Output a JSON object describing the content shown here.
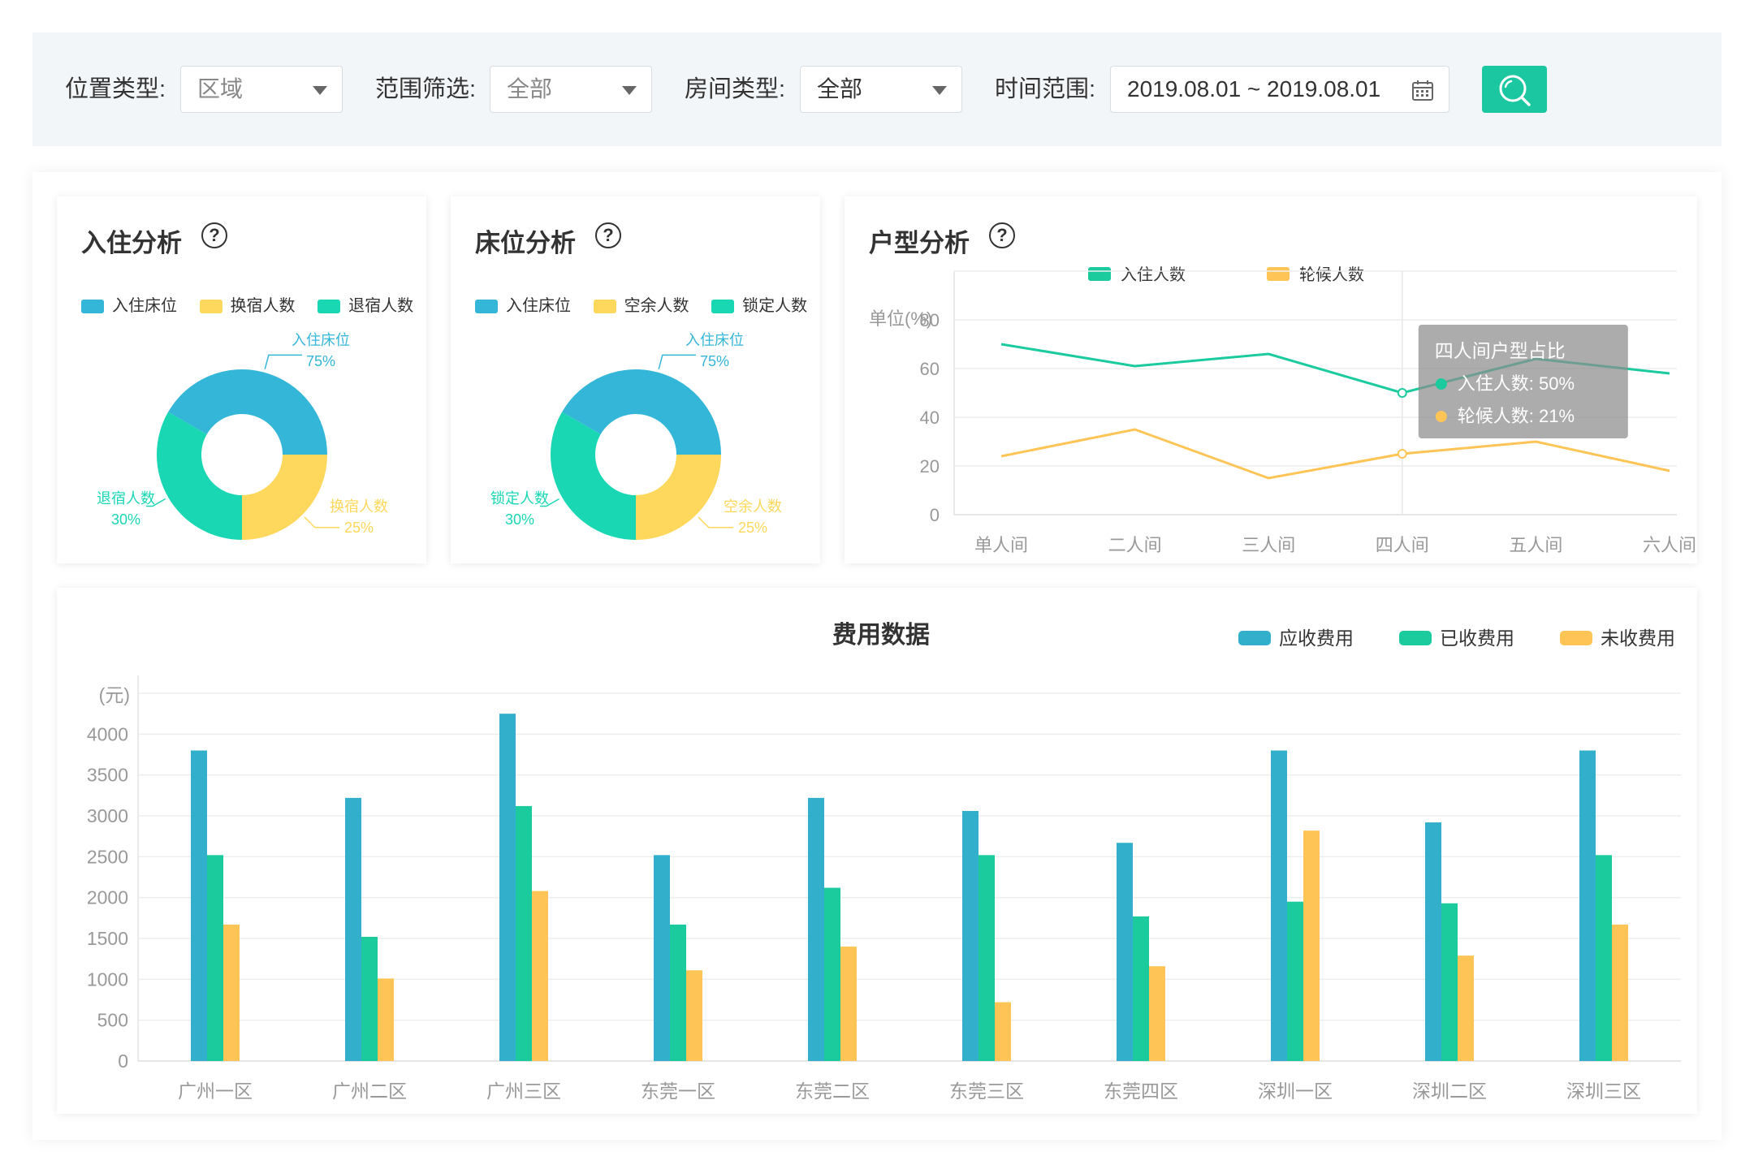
{
  "filters": [
    {
      "label": "位置类型:",
      "value": "区域"
    },
    {
      "label": "范围筛选:",
      "value": "全部"
    },
    {
      "label": "房间类型:",
      "value": "全部"
    },
    {
      "label": "时间范围:",
      "value": "2019.08.01 ~ 2019.08.01"
    }
  ],
  "colors": {
    "blue": "#34b6d8",
    "green": "#1ad7b4",
    "yellow": "#fdd85c",
    "bar_blue": "#32b0cb",
    "bar_green": "#1ccb9d",
    "bar_orange": "#fec556",
    "accent": "#1bc7a0"
  },
  "icons": {
    "calendar": "calendar-icon",
    "search": "search-icon",
    "help": "help-circle-icon",
    "dropdown": "caret-down-icon"
  },
  "chart_data": [
    {
      "type": "pie",
      "title": "入住分析",
      "help": "?",
      "legend": [
        "入住床位",
        "换宿人数",
        "退宿人数"
      ],
      "slices": [
        {
          "label": "入住床位",
          "value": 75,
          "display": "75%",
          "color": "#34b6d8"
        },
        {
          "label": "换宿人数",
          "value": 25,
          "display": "25%",
          "color": "#fdd85c"
        },
        {
          "label": "退宿人数",
          "value": 30,
          "display": "30%",
          "color": "#1ad7b4"
        }
      ]
    },
    {
      "type": "pie",
      "title": "床位分析",
      "help": "?",
      "legend": [
        "入住床位",
        "空余人数",
        "锁定人数"
      ],
      "slices": [
        {
          "label": "入住床位",
          "value": 75,
          "display": "75%",
          "color": "#34b6d8"
        },
        {
          "label": "空余人数",
          "value": 25,
          "display": "25%",
          "color": "#fdd85c"
        },
        {
          "label": "锁定人数",
          "value": 30,
          "display": "30%",
          "color": "#1ad7b4"
        }
      ]
    },
    {
      "type": "line",
      "title": "户型分析",
      "help": "?",
      "ylabel": "单位(%)",
      "ylim": [
        0,
        100
      ],
      "yticks": [
        0,
        20,
        40,
        60,
        80
      ],
      "categories": [
        "单人间",
        "二人间",
        "三人间",
        "四人间",
        "五人间",
        "六人间"
      ],
      "series": [
        {
          "name": "入住人数",
          "values": [
            70,
            61,
            66,
            50,
            64,
            58
          ],
          "color": "#1ccb9d"
        },
        {
          "name": "轮候人数",
          "values": [
            24,
            35,
            15,
            25,
            30,
            18
          ],
          "color": "#fec556"
        }
      ],
      "tooltip": {
        "title": "四人间户型占比",
        "index": 3,
        "lines": [
          "入住人数: 50%",
          "轮候人数: 21%"
        ]
      },
      "grid": true
    },
    {
      "type": "bar",
      "title": "费用数据",
      "ylabel": "(元)",
      "ylim": [
        0,
        4500
      ],
      "yticks": [
        0,
        500,
        1000,
        1500,
        2000,
        2500,
        3000,
        3500,
        4000
      ],
      "categories": [
        "广州一区",
        "广州二区",
        "广州三区",
        "东莞一区",
        "东莞二区",
        "东莞三区",
        "东莞四区",
        "深圳一区",
        "深圳二区",
        "深圳三区"
      ],
      "series": [
        {
          "name": "应收费用",
          "values": [
            3800,
            3220,
            4250,
            2520,
            3220,
            3060,
            2670,
            3800,
            2920,
            3800
          ],
          "color": "#32b0cb"
        },
        {
          "name": "已收费用",
          "values": [
            2520,
            1520,
            3120,
            1670,
            2120,
            2520,
            1770,
            1950,
            1930,
            2520
          ],
          "color": "#1ccb9d"
        },
        {
          "name": "未收费用",
          "values": [
            1670,
            1010,
            2080,
            1110,
            1400,
            720,
            1160,
            2820,
            1290,
            1670
          ],
          "color": "#fec556"
        }
      ],
      "legend_position": "top-right",
      "grid": true
    }
  ]
}
